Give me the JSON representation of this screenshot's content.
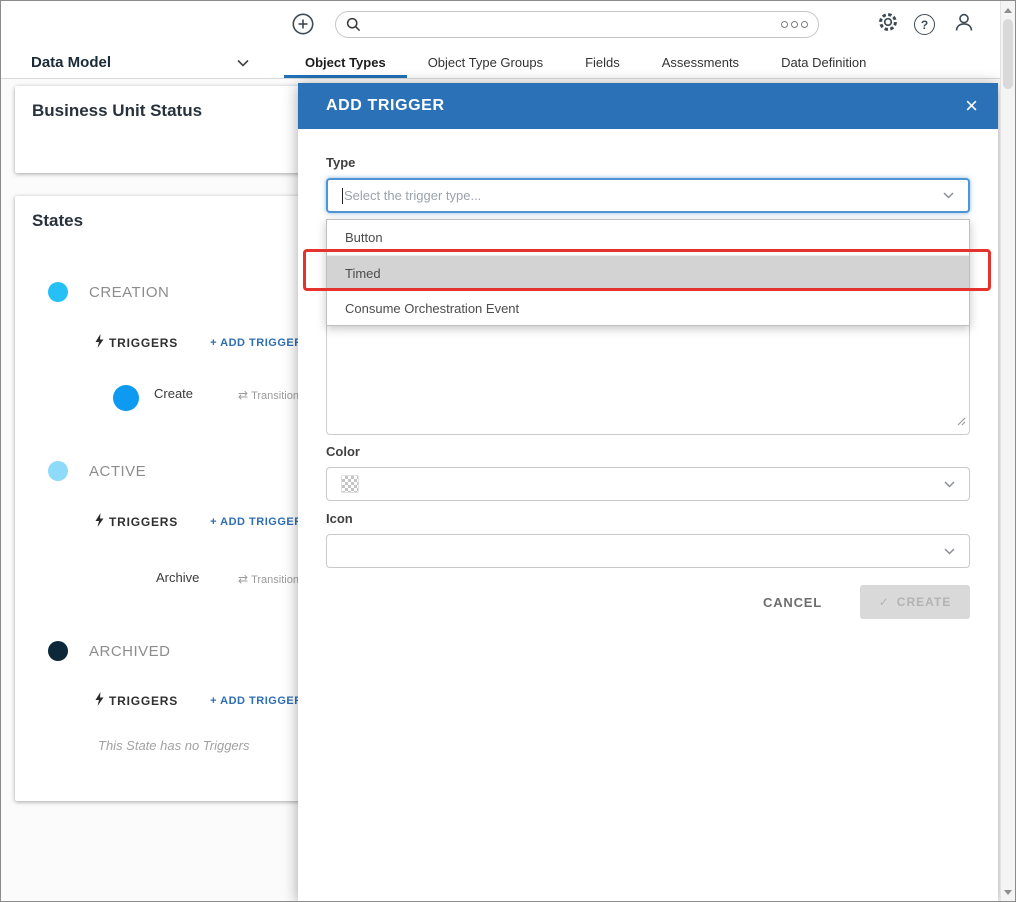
{
  "nav": {
    "dropdown_label": "Data Model",
    "tabs": [
      {
        "label": "Object Types",
        "active": true
      },
      {
        "label": "Object Type Groups",
        "active": false
      },
      {
        "label": "Fields",
        "active": false
      },
      {
        "label": "Assessments",
        "active": false
      },
      {
        "label": "Data Definition",
        "active": false
      }
    ]
  },
  "page": {
    "card1_title": "Business Unit Status",
    "card2_title": "States",
    "states": [
      {
        "name": "CREATION",
        "color": "#27c0f6",
        "triggers_label": "TRIGGERS",
        "add_label": "+ ADD TRIGGER"
      },
      {
        "name": "ACTIVE",
        "color": "#8edaf9",
        "triggers_label": "TRIGGERS",
        "add_label": "+ ADD TRIGGER"
      },
      {
        "name": "ARCHIVED",
        "color": "#0c2839",
        "triggers_label": "TRIGGERS",
        "add_label": "+ ADD TRIGGER"
      }
    ],
    "triggers": [
      {
        "name": "Create",
        "color": "#0d9af0",
        "transitions": "Transitions t"
      },
      {
        "name": "Archive",
        "transitions": "Transitions"
      }
    ],
    "empty_text": "This State has no Triggers"
  },
  "modal": {
    "title": "ADD TRIGGER",
    "type_label": "Type",
    "type_placeholder": "Select the trigger type...",
    "options": [
      {
        "label": "Button",
        "selected": false
      },
      {
        "label": "Timed",
        "selected": true
      },
      {
        "label": "Consume Orchestration Event",
        "selected": false
      }
    ],
    "color_label": "Color",
    "icon_label": "Icon",
    "cancel_label": "CANCEL",
    "create_label": "CREATE"
  },
  "icons": {
    "close": "×",
    "check": "✓",
    "transitions_arrows": "⇄",
    "help": "?"
  },
  "colors": {
    "modal_header": "#2a71b8",
    "accent_blue": "#2e6fb2",
    "active_tab_underline": "#2170b8",
    "annotation_red": "#e6322c",
    "selected_option_bg": "#d3d3d3",
    "disabled_button_bg": "#d9d9d9"
  }
}
